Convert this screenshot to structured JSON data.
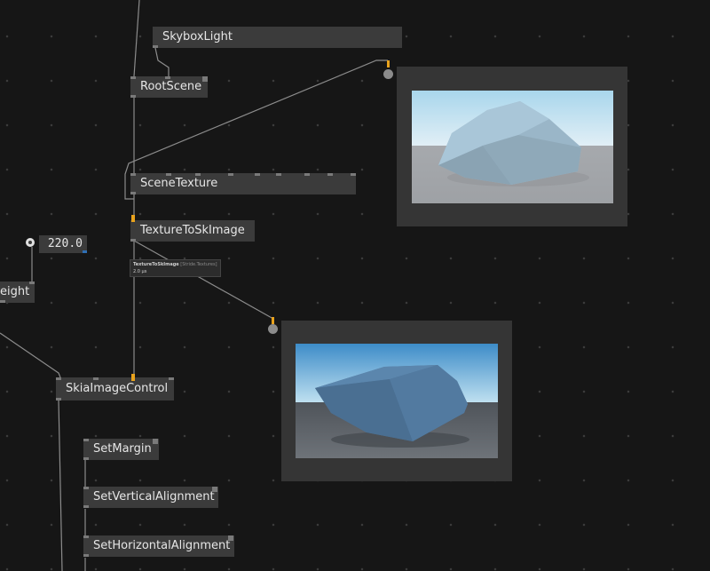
{
  "nodes": {
    "skybox_light": "SkyboxLight",
    "root_scene": "RootScene",
    "scene_texture": "SceneTexture",
    "texture_to_skimage": "TextureToSkImage",
    "height_partial": "eight",
    "skia_image_control": "SkiaImageControl",
    "set_margin": "SetMargin",
    "set_vertical_alignment": "SetVerticalAlignment",
    "set_horizontal_alignment": "SetHorizontalAlignment"
  },
  "iobox": {
    "value": "220.0"
  },
  "tooltip": {
    "name": "TextureToSkImage",
    "category": "[Stride.Textures]",
    "timing": "2.0 µs"
  },
  "colors": {
    "background": "#161616",
    "node": "#3b3b3b",
    "accent_pin": "#e8a21c",
    "wire": "#8c8c8c"
  },
  "icons": {
    "renderer_port": "circle-port-icon",
    "iobox_toggle": "radio-toggle-icon"
  }
}
